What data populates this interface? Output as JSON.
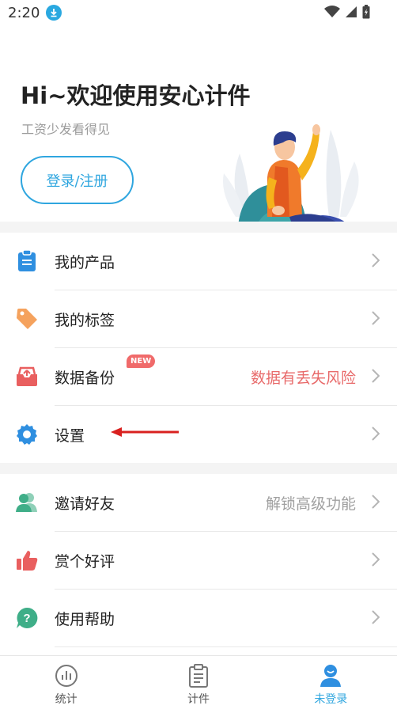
{
  "status_bar": {
    "time": "2:20"
  },
  "header": {
    "title": "Hi~欢迎使用安心计件",
    "subtitle": "工资少发看得见",
    "login_button": "登录/注册"
  },
  "menu": {
    "group1": [
      {
        "label": "我的产品",
        "icon": "clipboard-icon",
        "extra": ""
      },
      {
        "label": "我的标签",
        "icon": "tag-icon",
        "extra": ""
      },
      {
        "label": "数据备份",
        "icon": "backup-tray-icon",
        "extra": "数据有丢失风险",
        "badge": "NEW"
      },
      {
        "label": "设置",
        "icon": "gear-icon",
        "extra": ""
      }
    ],
    "group2": [
      {
        "label": "邀请好友",
        "icon": "users-icon",
        "extra": "解锁高级功能"
      },
      {
        "label": "赏个好评",
        "icon": "thumbs-up-icon",
        "extra": ""
      },
      {
        "label": "使用帮助",
        "icon": "help-bubble-icon",
        "extra": ""
      }
    ]
  },
  "tabbar": {
    "tabs": [
      {
        "label": "统计",
        "icon": "chart-circle-icon",
        "active": false
      },
      {
        "label": "计件",
        "icon": "clipboard-list-icon",
        "active": false
      },
      {
        "label": "未登录",
        "icon": "user-avatar-icon",
        "active": true
      }
    ]
  },
  "colors": {
    "accent": "#2fa6df",
    "warning": "#e86a6a",
    "muted": "#a0a0a0"
  }
}
